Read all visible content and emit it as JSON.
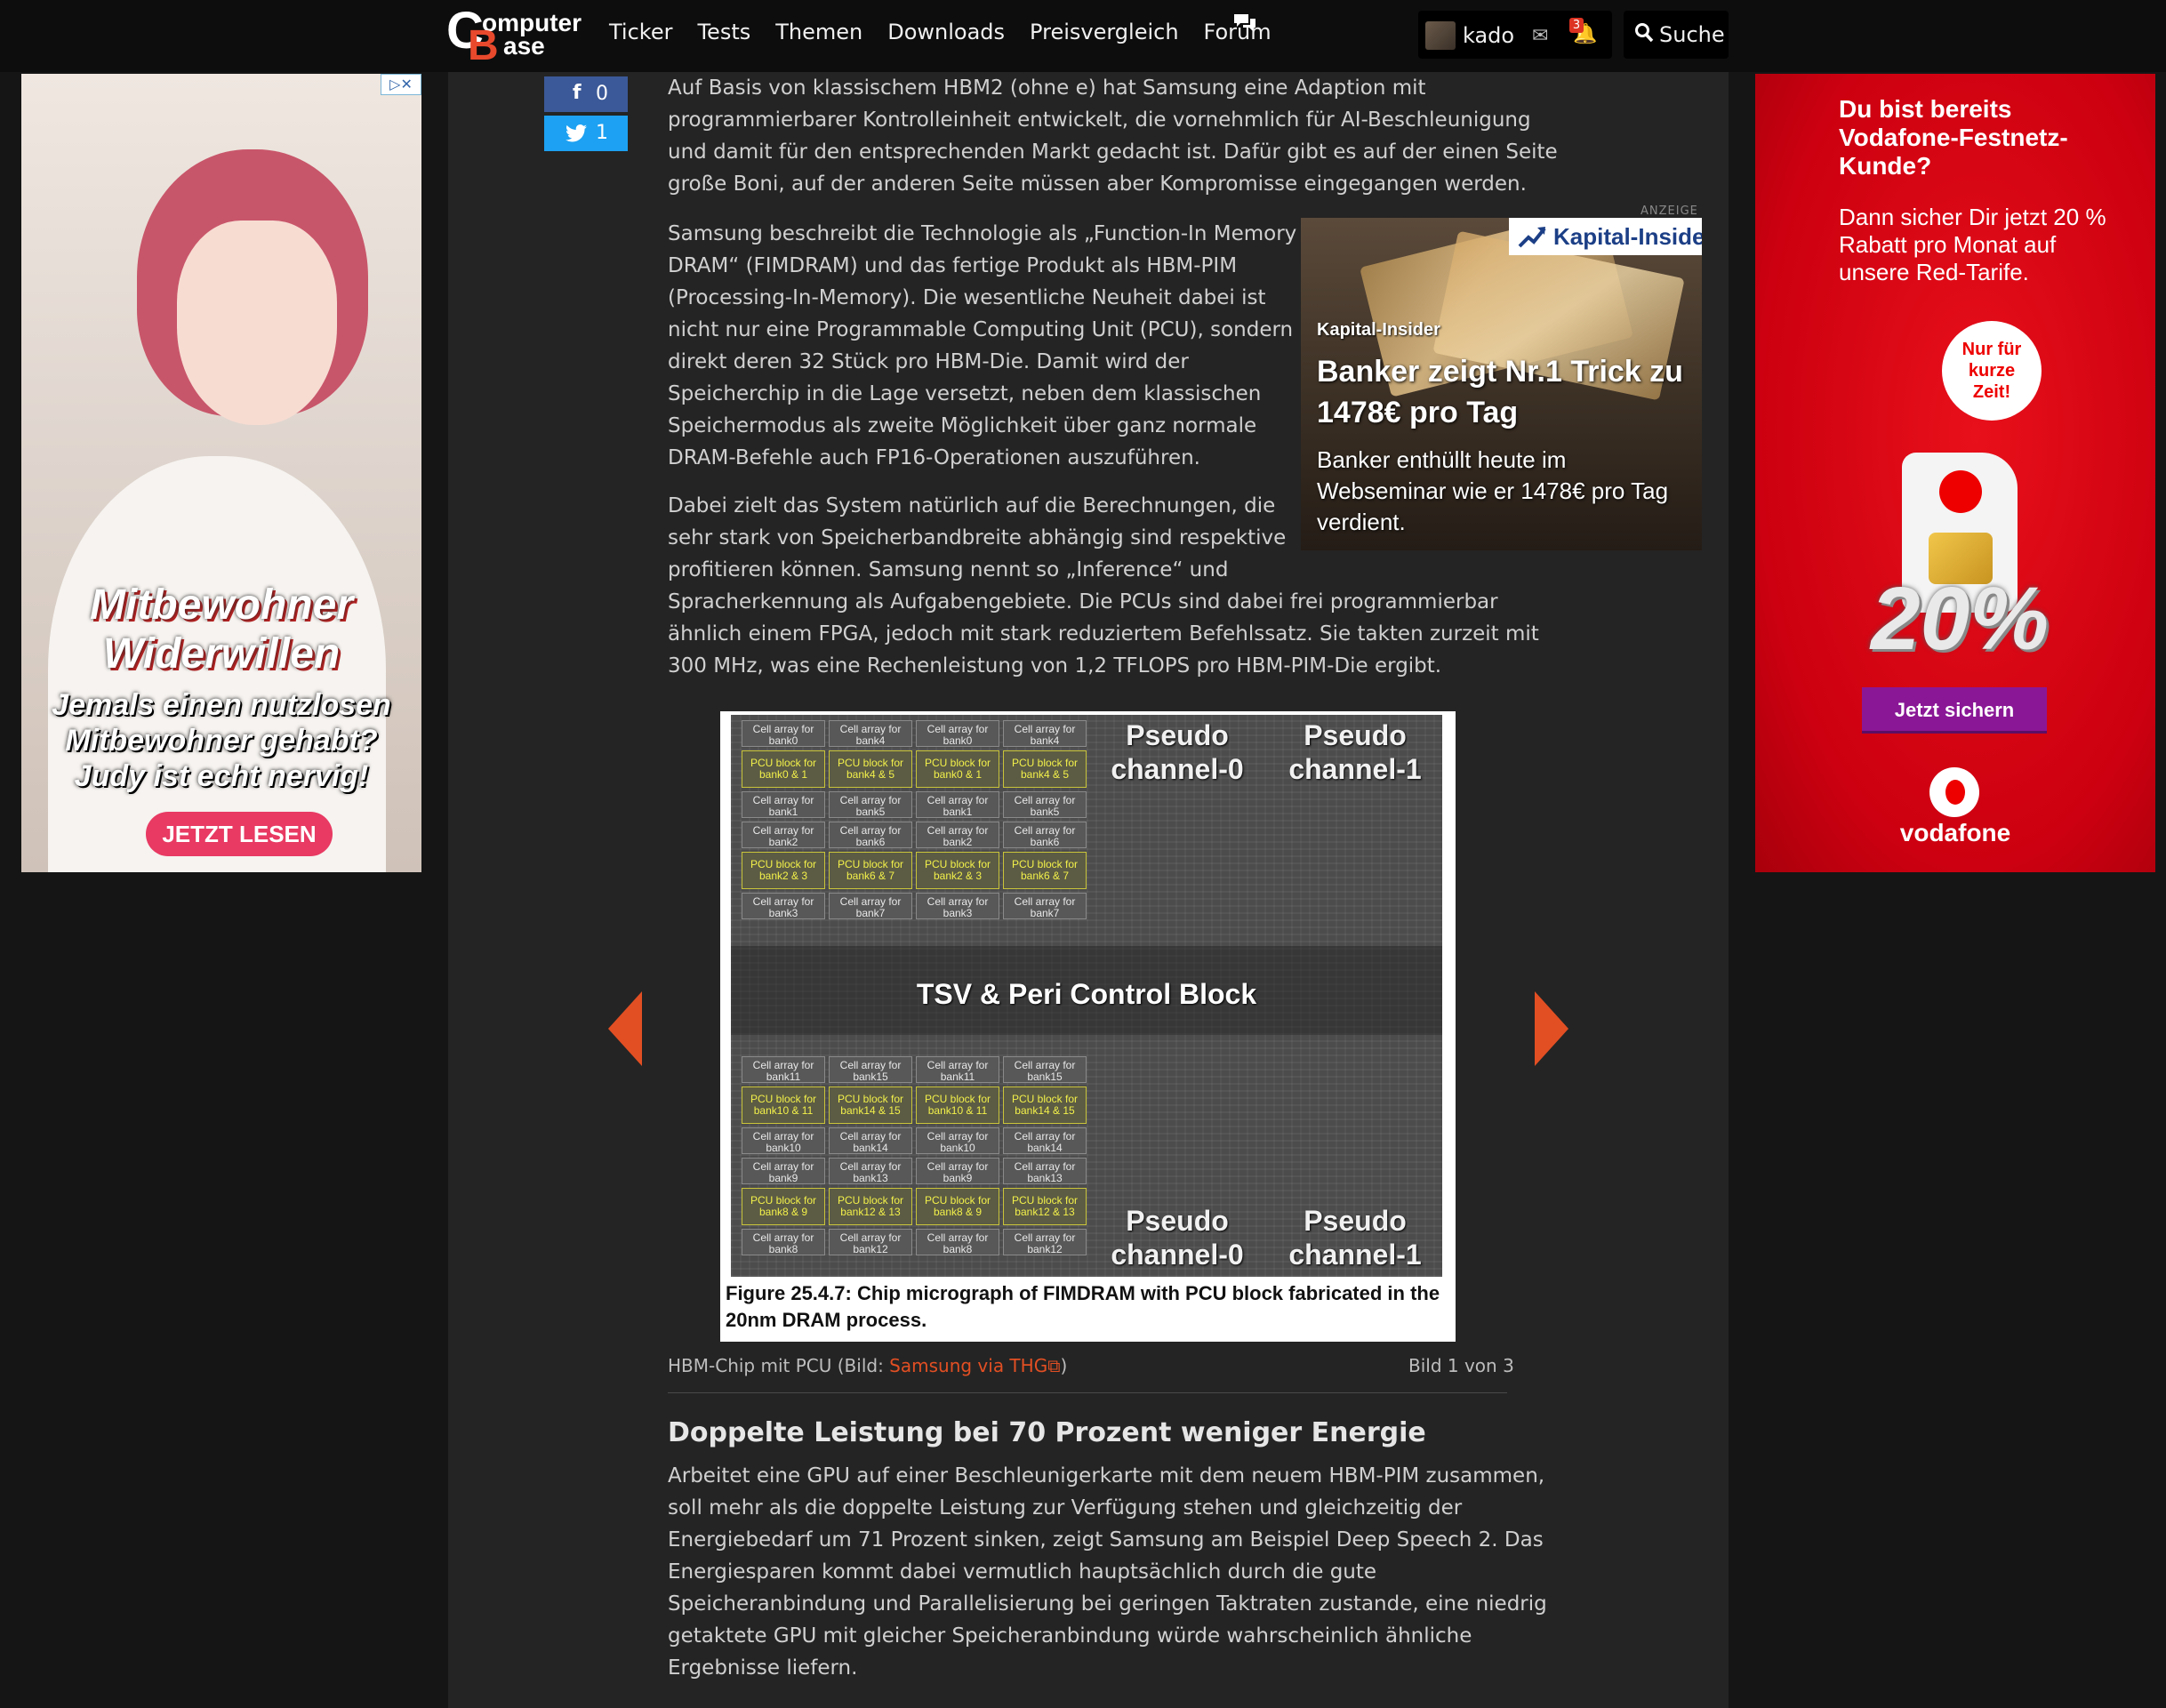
{
  "header": {
    "logo": {
      "c": "C",
      "b": "B",
      "line1": "omputer",
      "line2": "ase"
    },
    "nav": [
      "Ticker",
      "Tests",
      "Themen",
      "Downloads",
      "Preisvergleich",
      "Forum"
    ],
    "user": {
      "name": "kado",
      "notification_count": "3"
    },
    "search_label": "Suche"
  },
  "share": {
    "facebook_count": "0",
    "twitter_count": "1"
  },
  "ad_left": {
    "title_line1": "Mitbewohner",
    "title_line2": "Widerwillen",
    "tagline": [
      "Jemals einen nutzlosen",
      "Mitbewohner gehabt?",
      "Judy ist echt nervig!"
    ],
    "cta": "JETZT LESEN"
  },
  "ad_right": {
    "headline": "Du bist bereits Vodafone-Festnetz-Kunde?",
    "body": "Dann sicher Dir jetzt 20 % Rabatt pro Monat auf unsere Red-Tarife.",
    "bubble": [
      "Nur für",
      "kurze",
      "Zeit!"
    ],
    "discount": "20%",
    "button": "Jetzt sichern",
    "brand": "vodafone"
  },
  "ad_inline": {
    "label": "ANZEIGE",
    "brand": "Kapital-Insider",
    "source": "Kapital-Insider",
    "headline": "Banker zeigt Nr.1 Trick zu 1478€ pro Tag",
    "subline": "Banker enthüllt heute im Webseminar wie er 1478€ pro Tag verdient."
  },
  "article": {
    "p1": [
      "Auf Basis von klassischem HBM2 (ohne e) hat Samsung eine Adaption mit",
      "programmierbarer Kontrolleinheit entwickelt, die vornehmlich für AI-Beschleunigung",
      "und damit für den entsprechenden Markt gedacht ist. Dafür gibt es auf der einen Seite",
      "große Boni, auf der anderen Seite müssen aber Kompromisse eingegangen werden."
    ],
    "p2": [
      "Samsung beschreibt die Technologie als „Function-In Memory",
      "DRAM“ (FIMDRAM) und das fertige Produkt als HBM-PIM",
      "(Processing-In-Memory). Die wesentliche Neuheit dabei ist",
      "nicht nur eine Programmable Computing Unit (PCU), sondern",
      "direkt deren 32 Stück pro HBM-Die. Damit wird der",
      "Speicherchip in die Lage versetzt, neben dem klassischen",
      "Speichermodus als zweite Möglichkeit über ganz normale",
      "DRAM-Befehle auch FP16-Operationen auszuführen."
    ],
    "p3": [
      "Dabei zielt das System natürlich auf die Berechnungen, die",
      "sehr stark von Speicherbandbreite abhängig sind respektive",
      "profitieren können. Samsung nennt so „Inference“ und",
      "Spracherkennung als Aufgabengebiete. Die PCUs sind dabei frei programmierbar",
      "ähnlich einem FPGA, jedoch mit stark reduziertem Befehlssatz. Sie takten zurzeit mit",
      "300 MHz, was eine Rechenleistung von 1,2 TFLOPS pro HBM-PIM-Die ergibt."
    ],
    "figure": {
      "cells_top": [
        [
          "Cell array for bank0",
          "Cell array for bank4",
          "Cell array for bank0",
          "Cell array for bank4"
        ],
        [
          "PCU block for bank0 & 1",
          "PCU block for bank4 & 5",
          "PCU block for bank0 & 1",
          "PCU block for bank4 & 5"
        ],
        [
          "Cell array for bank1",
          "Cell array for bank5",
          "Cell array for bank1",
          "Cell array for bank5"
        ],
        [
          "Cell array for bank2",
          "Cell array for bank6",
          "Cell array for bank2",
          "Cell array for bank6"
        ],
        [
          "PCU block for bank2 & 3",
          "PCU block for bank6 & 7",
          "PCU block for bank2 & 3",
          "PCU block for bank6 & 7"
        ],
        [
          "Cell array for bank3",
          "Cell array for bank7",
          "Cell array for bank3",
          "Cell array for bank7"
        ]
      ],
      "cells_bottom": [
        [
          "Cell array for bank11",
          "Cell array for bank15",
          "Cell array for bank11",
          "Cell array for bank15"
        ],
        [
          "PCU block for bank10 & 11",
          "PCU block for bank14 & 15",
          "PCU block for bank10 & 11",
          "PCU block for bank14 & 15"
        ],
        [
          "Cell array for bank10",
          "Cell array for bank14",
          "Cell array for bank10",
          "Cell array for bank14"
        ],
        [
          "Cell array for bank9",
          "Cell array for bank13",
          "Cell array for bank9",
          "Cell array for bank13"
        ],
        [
          "PCU block for bank8 & 9",
          "PCU block for bank12 & 13",
          "PCU block for bank8 & 9",
          "PCU block for bank12 & 13"
        ],
        [
          "Cell array for bank8",
          "Cell array for bank12",
          "Cell array for bank8",
          "Cell array for bank12"
        ]
      ],
      "pseudo_top": [
        "Pseudo channel-0",
        "Pseudo channel-1"
      ],
      "pseudo_bottom": [
        "Pseudo channel-0",
        "Pseudo channel-1"
      ],
      "center_label": "TSV & Peri Control Block",
      "caption": "Figure 25.4.7: Chip micrograph of FIMDRAM with PCU block fabricated in the 20nm DRAM process."
    },
    "image_caption": {
      "prefix": "HBM-Chip mit PCU (Bild: ",
      "link": "Samsung via THG",
      "suffix": ")"
    },
    "image_count": "Bild 1 von 3",
    "heading": "Doppelte Leistung bei 70 Prozent weniger Energie",
    "p4": [
      "Arbeitet eine GPU auf einer Beschleunigerkarte mit dem neuem HBM-PIM zusammen,",
      "soll mehr als die doppelte Leistung zur Verfügung stehen und gleichzeitig der",
      "Energiebedarf um 71 Prozent sinken, zeigt Samsung am Beispiel Deep Speech 2. Das",
      "Energiesparen kommt dabei vermutlich hauptsächlich durch die gute",
      "Speicheranbindung und Parallelisierung bei geringen Taktraten zustande, eine niedrig",
      "getaktete GPU mit gleicher Speicheranbindung würde wahrscheinlich ähnliche",
      "Ergebnisse liefern."
    ]
  }
}
